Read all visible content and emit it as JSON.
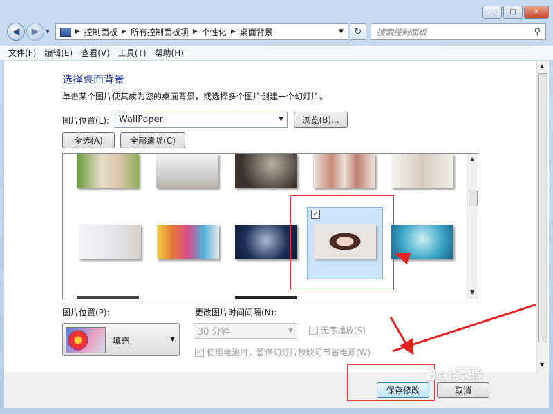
{
  "window": {
    "minimize_label": "–",
    "maximize_label": "□",
    "close_label": "✕"
  },
  "nav": {
    "breadcrumbs": [
      "控制面板",
      "所有控制面板项",
      "个性化",
      "桌面背景"
    ],
    "search_placeholder": "搜索控制面板"
  },
  "menu": [
    "文件(F)",
    "编辑(E)",
    "查看(V)",
    "工具(T)",
    "帮助(H)"
  ],
  "page": {
    "title": "选择桌面背景",
    "description": "单击某个图片使其成为您的桌面背景，或选择多个图片创建一个幻灯片。",
    "picture_location_label": "图片位置(L):",
    "picture_location_value": "WallPaper",
    "browse_label": "浏览(B)...",
    "select_all_label": "全选(A)",
    "clear_all_label": "全部清除(C)"
  },
  "options": {
    "position_label": "图片位置(P):",
    "position_value": "填充",
    "interval_label": "更改图片时间间隔(N):",
    "interval_value": "30 分钟",
    "shuffle_label": "无序播放(S)",
    "battery_label": "使用电池时，暂停幻灯片放映可节省电源(W)"
  },
  "footer": {
    "save_label": "保存修改",
    "cancel_label": "取消"
  },
  "watermark": "Bai经验"
}
